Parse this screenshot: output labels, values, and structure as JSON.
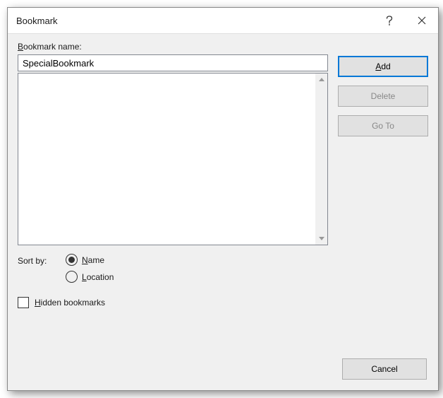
{
  "titlebar": {
    "title": "Bookmark"
  },
  "labels": {
    "bookmark_name": "Bookmark name:",
    "bookmark_name_accel": "B",
    "sort_by": "Sort by:",
    "hidden": "Hidden bookmarks",
    "hidden_accel": "H"
  },
  "input": {
    "value": "SpecialBookmark"
  },
  "buttons": {
    "add": "Add",
    "add_accel": "A",
    "delete": "Delete",
    "goto": "Go To",
    "cancel": "Cancel"
  },
  "sort": {
    "name": "Name",
    "name_accel": "N",
    "location": "Location",
    "location_accel": "L",
    "selected": "name"
  },
  "hidden_checked": false,
  "bookmarks": []
}
